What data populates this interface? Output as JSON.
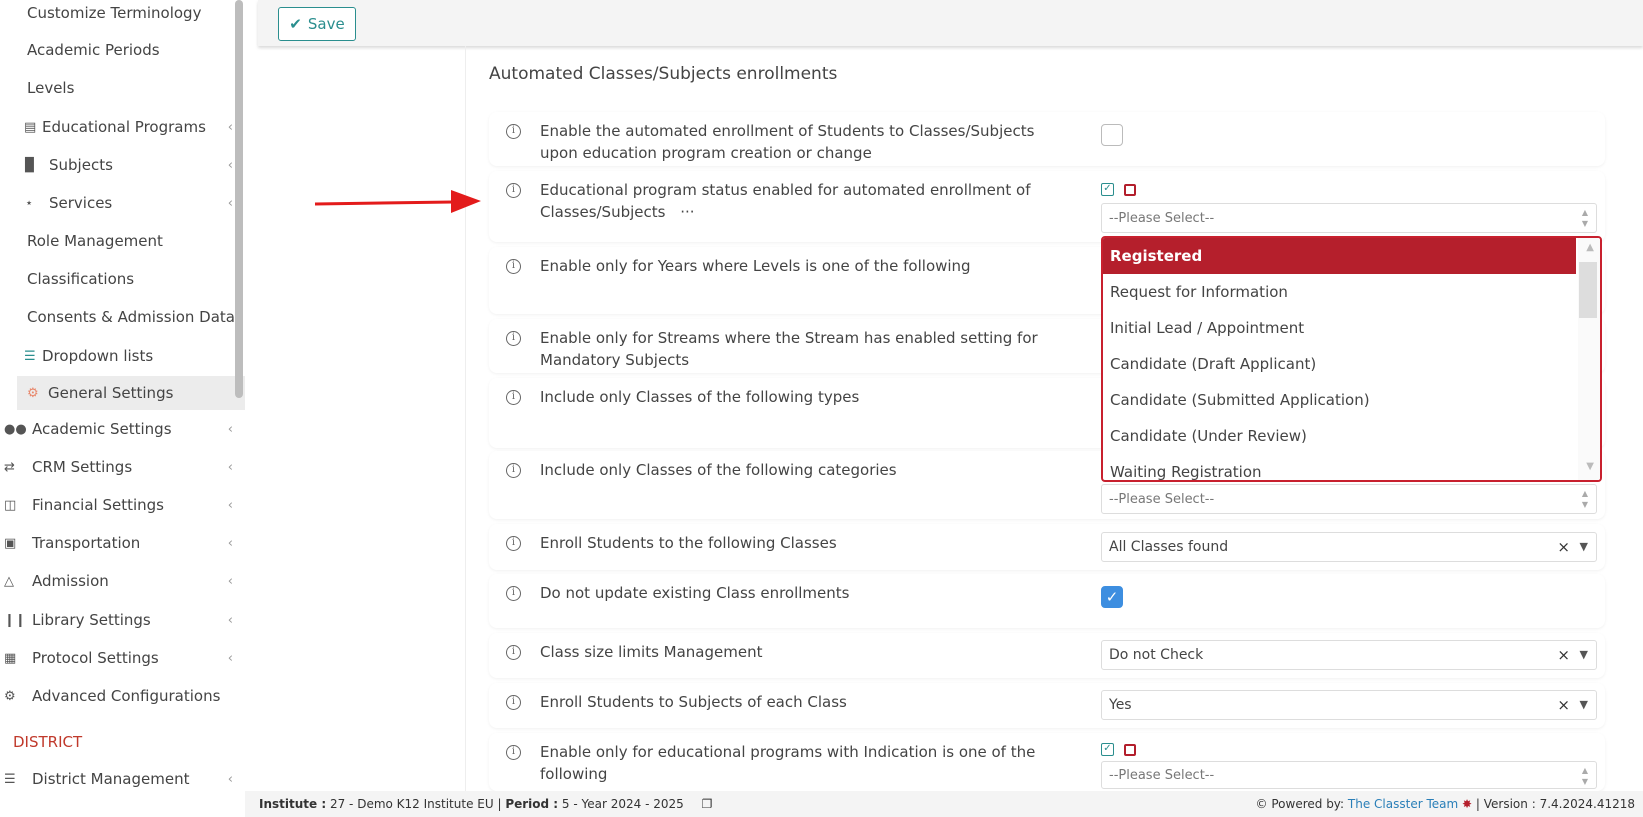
{
  "sidebar": {
    "sub_items": [
      {
        "label": "Customize Terminology",
        "icon": ""
      },
      {
        "label": "Academic Periods",
        "icon": ""
      },
      {
        "label": "Levels",
        "icon": ""
      },
      {
        "label": "Educational Programs",
        "icon": "server-icon"
      },
      {
        "label": "Subjects",
        "icon": "book-icon"
      },
      {
        "label": "Services",
        "icon": "network-icon"
      },
      {
        "label": "Role Management",
        "icon": ""
      },
      {
        "label": "Classifications",
        "icon": ""
      },
      {
        "label": "Consents & Admission Data",
        "icon": ""
      },
      {
        "label": "Dropdown lists",
        "icon": "layers-icon"
      },
      {
        "label": "General Settings",
        "icon": "gears-icon"
      }
    ],
    "top_items": [
      {
        "label": "Academic Settings",
        "icon": "users-icon"
      },
      {
        "label": "CRM Settings",
        "icon": "shuffle-icon"
      },
      {
        "label": "Financial Settings",
        "icon": "coins-icon"
      },
      {
        "label": "Transportation",
        "icon": "bus-icon"
      },
      {
        "label": "Admission",
        "icon": "bank-icon"
      },
      {
        "label": "Library Settings",
        "icon": "library-icon"
      },
      {
        "label": "Protocol Settings",
        "icon": "calendar-icon"
      },
      {
        "label": "Advanced Configurations",
        "icon": "cogs-icon"
      }
    ],
    "district_label": "DISTRICT",
    "district_item": "District Management"
  },
  "toolbar": {
    "save_label": "Save"
  },
  "section_title": "Automated Classes/Subjects enrollments",
  "rows": [
    {
      "label": "Enable the automated enrollment of Students to Classes/Subjects upon education program creation or change"
    },
    {
      "label": "Educational program status enabled for automated enrollment of Classes/Subjects",
      "ellipsis": "···",
      "placeholder": "--Please Select--"
    },
    {
      "label": "Enable only for Years where Levels is one of the following"
    },
    {
      "label": "Enable only for Streams where the Stream has enabled setting for Mandatory Subjects"
    },
    {
      "label": "Include only Classes of the following types"
    },
    {
      "label": "Include only Classes of the following categories",
      "placeholder": "--Please Select--"
    },
    {
      "label": "Enroll Students to the following Classes",
      "value": "All Classes found"
    },
    {
      "label": "Do not update existing Class enrollments"
    },
    {
      "label": "Class size limits Management",
      "value": "Do not Check"
    },
    {
      "label": "Enroll Students to Subjects of each Class",
      "value": "Yes"
    },
    {
      "label": "Enable only for educational programs with Indication is one of the following",
      "placeholder": "--Please Select--"
    }
  ],
  "dropdown": {
    "options": [
      "Registered",
      "Request for Information",
      "Initial Lead / Appointment",
      "Candidate (Draft Applicant)",
      "Candidate (Submitted Application)",
      "Candidate (Under Review)",
      "Waiting Registration"
    ],
    "selected": "Registered"
  },
  "footer": {
    "institute_label": "Institute :",
    "institute_value": "27 - Demo K12 Institute EU",
    "period_label": "Period :",
    "period_value": "5 - Year 2024 - 2025",
    "powered_by": "Powered by:",
    "team": "The Classter Team",
    "version_label": "Version :",
    "version_value": "7.4.2024.41218"
  },
  "colors": {
    "accent": "#2a8e8e",
    "brand_red": "#b51f2c",
    "checkbox_blue": "#3d8ee0"
  }
}
